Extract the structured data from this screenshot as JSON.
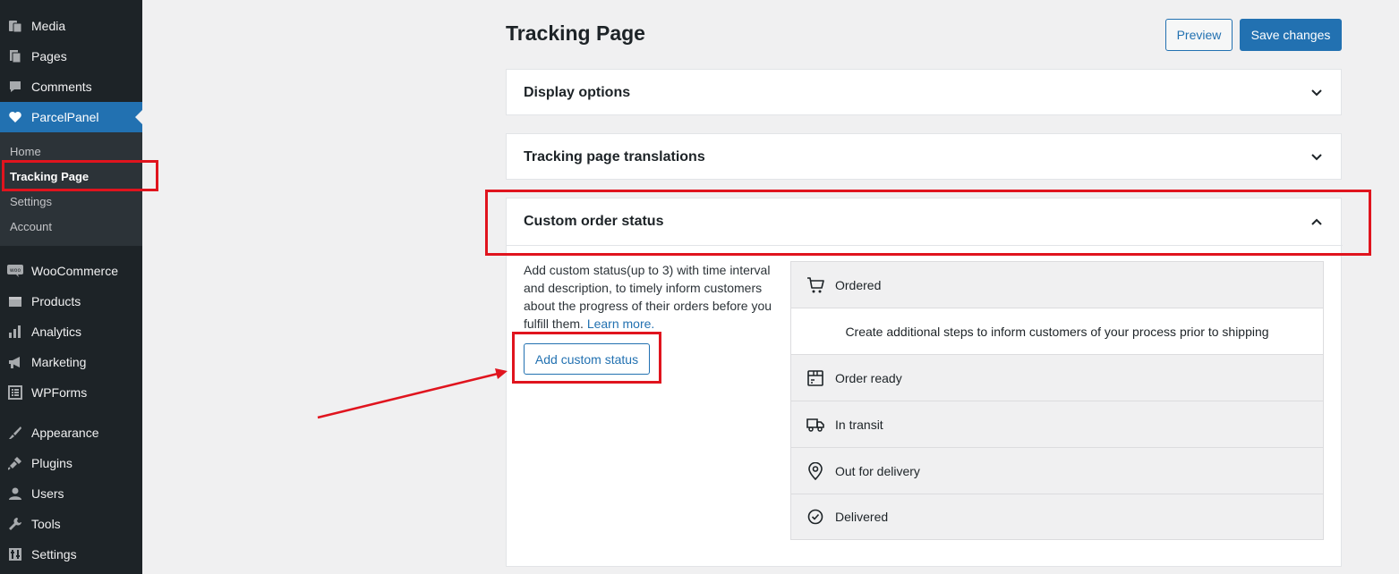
{
  "sidebar": {
    "items": [
      {
        "label": "Media",
        "icon": "media-icon"
      },
      {
        "label": "Pages",
        "icon": "pages-icon"
      },
      {
        "label": "Comments",
        "icon": "comments-icon"
      },
      {
        "label": "ParcelPanel",
        "icon": "heart-icon"
      },
      {
        "label": "WooCommerce",
        "icon": "woocommerce-icon"
      },
      {
        "label": "Products",
        "icon": "products-icon"
      },
      {
        "label": "Analytics",
        "icon": "analytics-icon"
      },
      {
        "label": "Marketing",
        "icon": "megaphone-icon"
      },
      {
        "label": "WPForms",
        "icon": "wpforms-icon"
      },
      {
        "label": "Appearance",
        "icon": "brush-icon"
      },
      {
        "label": "Plugins",
        "icon": "plug-icon"
      },
      {
        "label": "Users",
        "icon": "user-icon"
      },
      {
        "label": "Tools",
        "icon": "wrench-icon"
      },
      {
        "label": "Settings",
        "icon": "settings-icon"
      }
    ],
    "submenu": [
      {
        "label": "Home"
      },
      {
        "label": "Tracking Page"
      },
      {
        "label": "Settings"
      },
      {
        "label": "Account"
      }
    ]
  },
  "header": {
    "title": "Tracking Page",
    "preview_label": "Preview",
    "save_label": "Save changes"
  },
  "cards": {
    "display_options": "Display options",
    "translations": "Tracking page translations",
    "custom_status": "Custom order status"
  },
  "custom_status": {
    "description": "Add custom status(up to 3) with time interval and description, to timely inform customers about the progress of their orders before you fulfill them.",
    "learn_more": "Learn more.",
    "add_button": "Add custom status",
    "note": "Create additional steps to inform customers of your process prior to shipping",
    "statuses": [
      {
        "label": "Ordered",
        "icon": "cart-icon"
      },
      {
        "label": "Order ready",
        "icon": "box-icon"
      },
      {
        "label": "In transit",
        "icon": "truck-icon"
      },
      {
        "label": "Out for delivery",
        "icon": "location-pin-icon"
      },
      {
        "label": "Delivered",
        "icon": "check-circle-icon"
      }
    ]
  },
  "colors": {
    "sidebar_bg": "#1d2327",
    "accent": "#2271b1",
    "annotation": "#e0141e"
  }
}
